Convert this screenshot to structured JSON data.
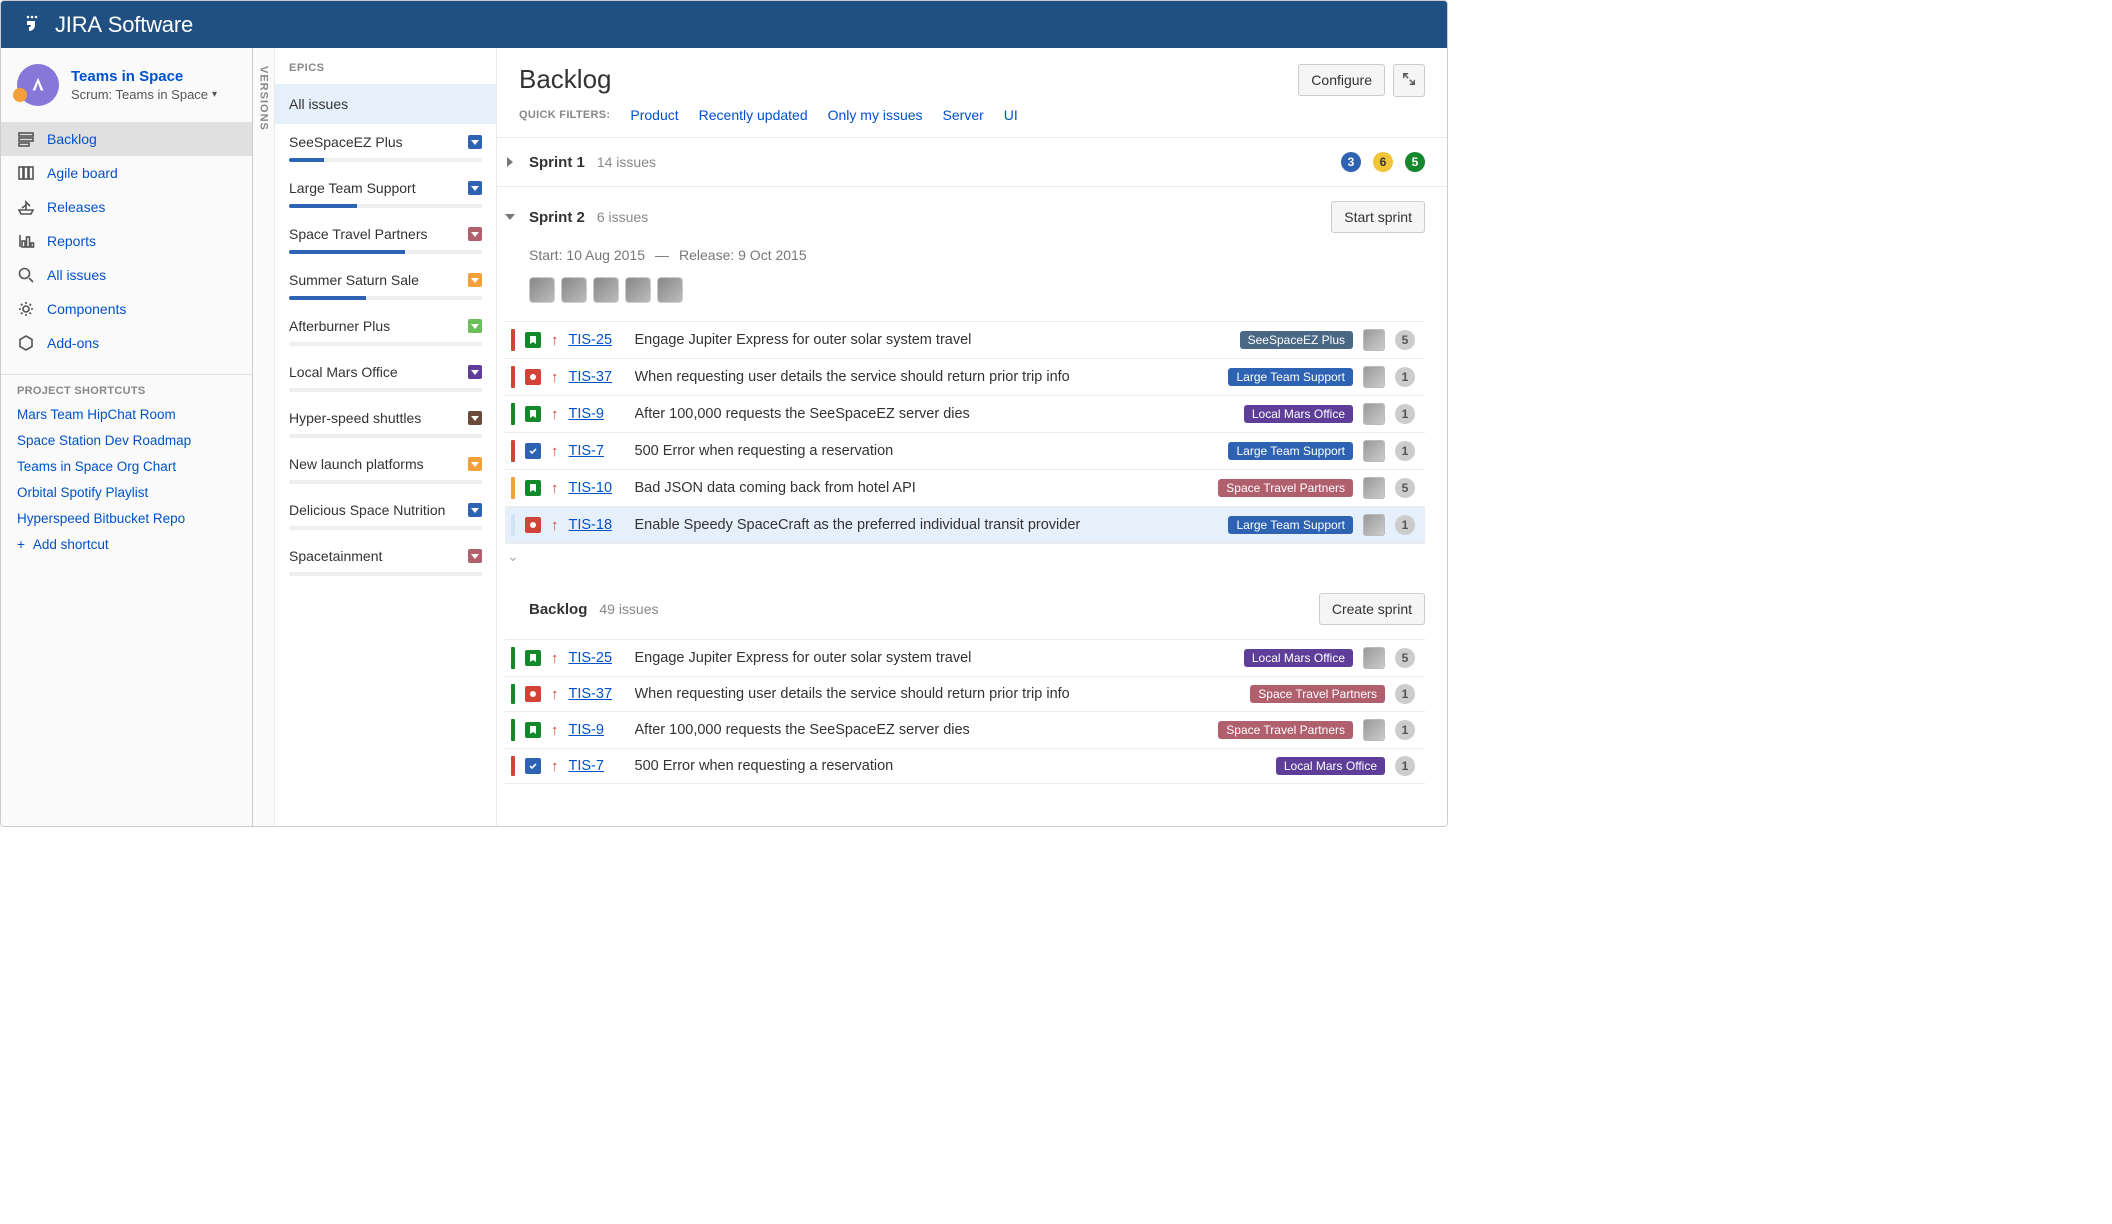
{
  "app": {
    "brand_bold": "JIRA",
    "brand_light": " Software"
  },
  "project": {
    "name": "Teams in Space",
    "subtitle": "Scrum: Teams in Space"
  },
  "sidebar": {
    "items": [
      {
        "label": "Backlog",
        "icon": "backlog",
        "active": true
      },
      {
        "label": "Agile board",
        "icon": "board",
        "active": false
      },
      {
        "label": "Releases",
        "icon": "ship",
        "active": false
      },
      {
        "label": "Reports",
        "icon": "reports",
        "active": false
      },
      {
        "label": "All issues",
        "icon": "search",
        "active": false
      },
      {
        "label": "Components",
        "icon": "gear",
        "active": false
      },
      {
        "label": "Add-ons",
        "icon": "addon",
        "active": false
      }
    ],
    "shortcuts_label": "PROJECT SHORTCUTS",
    "shortcuts": [
      "Mars Team HipChat Room",
      "Space Station Dev Roadmap",
      "Teams in Space Org Chart",
      "Orbital Spotify Playlist",
      "Hyperspeed Bitbucket Repo"
    ],
    "add_shortcut": "Add shortcut"
  },
  "versions_label": "VERSIONS",
  "epics": {
    "title": "EPICS",
    "all": "All issues",
    "items": [
      {
        "name": "SeeSpaceEZ Plus",
        "color": "#2e63b3",
        "progress": 18
      },
      {
        "name": "Large Team Support",
        "color": "#2e63b3",
        "progress": 35
      },
      {
        "name": "Space Travel Partners",
        "color": "#b05f6d",
        "progress": 60
      },
      {
        "name": "Summer Saturn Sale",
        "color": "#f2a13a",
        "progress": 40
      },
      {
        "name": "Afterburner Plus",
        "color": "#6abf59",
        "progress": 0
      },
      {
        "name": "Local Mars Office",
        "color": "#5f3e99",
        "progress": 0
      },
      {
        "name": "Hyper-speed shuttles",
        "color": "#6b4a3a",
        "progress": 0
      },
      {
        "name": "New launch platforms",
        "color": "#f2a13a",
        "progress": 0
      },
      {
        "name": "Delicious Space Nutrition",
        "color": "#2e63b3",
        "progress": 0
      },
      {
        "name": "Spacetainment",
        "color": "#b05f6d",
        "progress": 0
      }
    ]
  },
  "page": {
    "title": "Backlog",
    "configure": "Configure",
    "quick_filters_label": "QUICK FILTERS:",
    "filters": [
      "Product",
      "Recently updated",
      "Only my issues",
      "Server",
      "UI"
    ]
  },
  "sprint1": {
    "name": "Sprint 1",
    "count": "14 issues",
    "pills": {
      "todo": "3",
      "inprog": "6",
      "done": "5"
    }
  },
  "sprint2": {
    "name": "Sprint 2",
    "count": "6 issues",
    "start_sprint": "Start sprint",
    "start_label": "Start: 10 Aug 2015",
    "release_label": "Release: 9 Oct 2015",
    "issues": [
      {
        "bar": "#d04437",
        "type": "story",
        "key": "TIS-25",
        "summary": "Engage Jupiter Express for outer solar system travel",
        "epic": "SeeSpaceEZ Plus",
        "epic_color": "#4a6785",
        "count": "5"
      },
      {
        "bar": "#d04437",
        "type": "bug",
        "key": "TIS-37",
        "summary": "When requesting user details the service should return prior trip info",
        "epic": "Large Team Support",
        "epic_color": "#2e63b3",
        "count": "1"
      },
      {
        "bar": "#14892c",
        "type": "story",
        "key": "TIS-9",
        "summary": "After 100,000 requests the SeeSpaceEZ server dies",
        "epic": "Local Mars Office",
        "epic_color": "#5f3e99",
        "count": "1"
      },
      {
        "bar": "#d04437",
        "type": "task",
        "key": "TIS-7",
        "summary": "500 Error when requesting a reservation",
        "epic": "Large Team Support",
        "epic_color": "#2e63b3",
        "count": "1"
      },
      {
        "bar": "#f2a13a",
        "type": "story",
        "key": "TIS-10",
        "summary": "Bad JSON data coming back from hotel API",
        "epic": "Space Travel Partners",
        "epic_color": "#b05f6d",
        "count": "5"
      },
      {
        "bar": "#cfe4f7",
        "type": "bug",
        "key": "TIS-18",
        "summary": "Enable Speedy SpaceCraft as the preferred individual transit provider",
        "epic": "Large Team Support",
        "epic_color": "#2e63b3",
        "count": "1",
        "selected": true
      }
    ]
  },
  "backlog": {
    "name": "Backlog",
    "count": "49 issues",
    "create_sprint": "Create sprint",
    "issues": [
      {
        "bar": "#14892c",
        "type": "story",
        "key": "TIS-25",
        "summary": "Engage Jupiter Express for outer solar system travel",
        "epic": "Local Mars Office",
        "epic_color": "#5f3e99",
        "count": "5"
      },
      {
        "bar": "#14892c",
        "type": "bug",
        "key": "TIS-37",
        "summary": "When requesting user details the service should return prior trip info",
        "epic": "Space Travel Partners",
        "epic_color": "#b05f6d",
        "count": "1"
      },
      {
        "bar": "#14892c",
        "type": "story",
        "key": "TIS-9",
        "summary": "After 100,000 requests the SeeSpaceEZ server dies",
        "epic": "Space Travel Partners",
        "epic_color": "#b05f6d",
        "count": "1"
      },
      {
        "bar": "#d04437",
        "type": "task",
        "key": "TIS-7",
        "summary": "500 Error when requesting a reservation",
        "epic": "Local Mars Office",
        "epic_color": "#5f3e99",
        "count": "1"
      }
    ]
  }
}
